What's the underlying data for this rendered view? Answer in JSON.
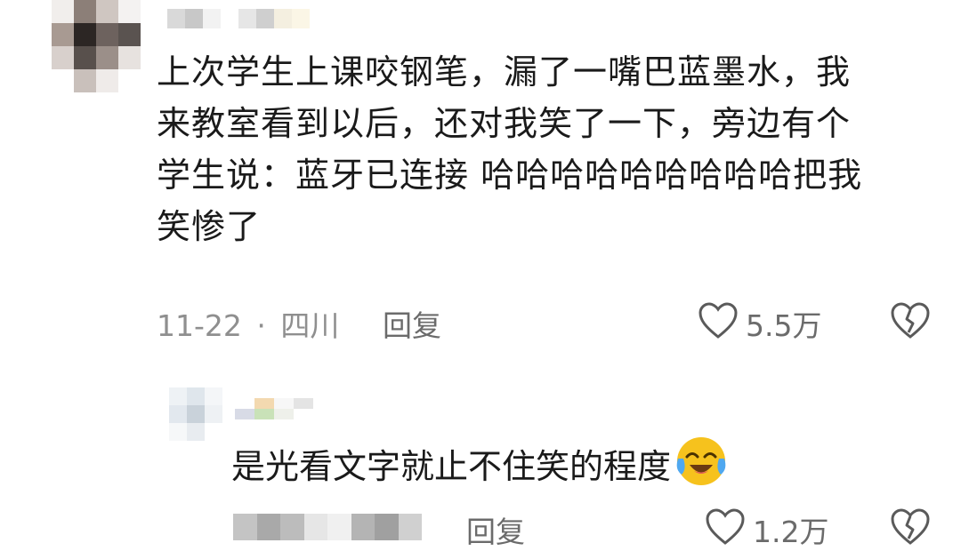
{
  "comment": {
    "lines": [
      "上次学生上课咬钢笔，漏了一嘴巴蓝墨水，我",
      "来教室看到以后，还对我笑了一下，旁边有个",
      "学生说：蓝牙已连接 哈哈哈哈哈哈哈哈哈把我",
      "笑惨了"
    ],
    "date": "11-22",
    "separator": "·",
    "location": "四川",
    "reply_label": "回复",
    "likes": "5.5万",
    "icons": {
      "like": "heart-outline-icon",
      "dislike": "broken-heart-icon"
    }
  },
  "reply": {
    "text": "是光看文字就止不住笑的程度",
    "emoji": "crying-laughing-emoji",
    "reply_label": "回复",
    "likes": "1.2万",
    "icons": {
      "like": "heart-outline-icon",
      "dislike": "broken-heart-icon"
    }
  },
  "colors": {
    "text": "#1a1a1a",
    "meta": "#8f8f8f",
    "icon": "#5a5a5a",
    "emoji": "#f6c21d"
  }
}
